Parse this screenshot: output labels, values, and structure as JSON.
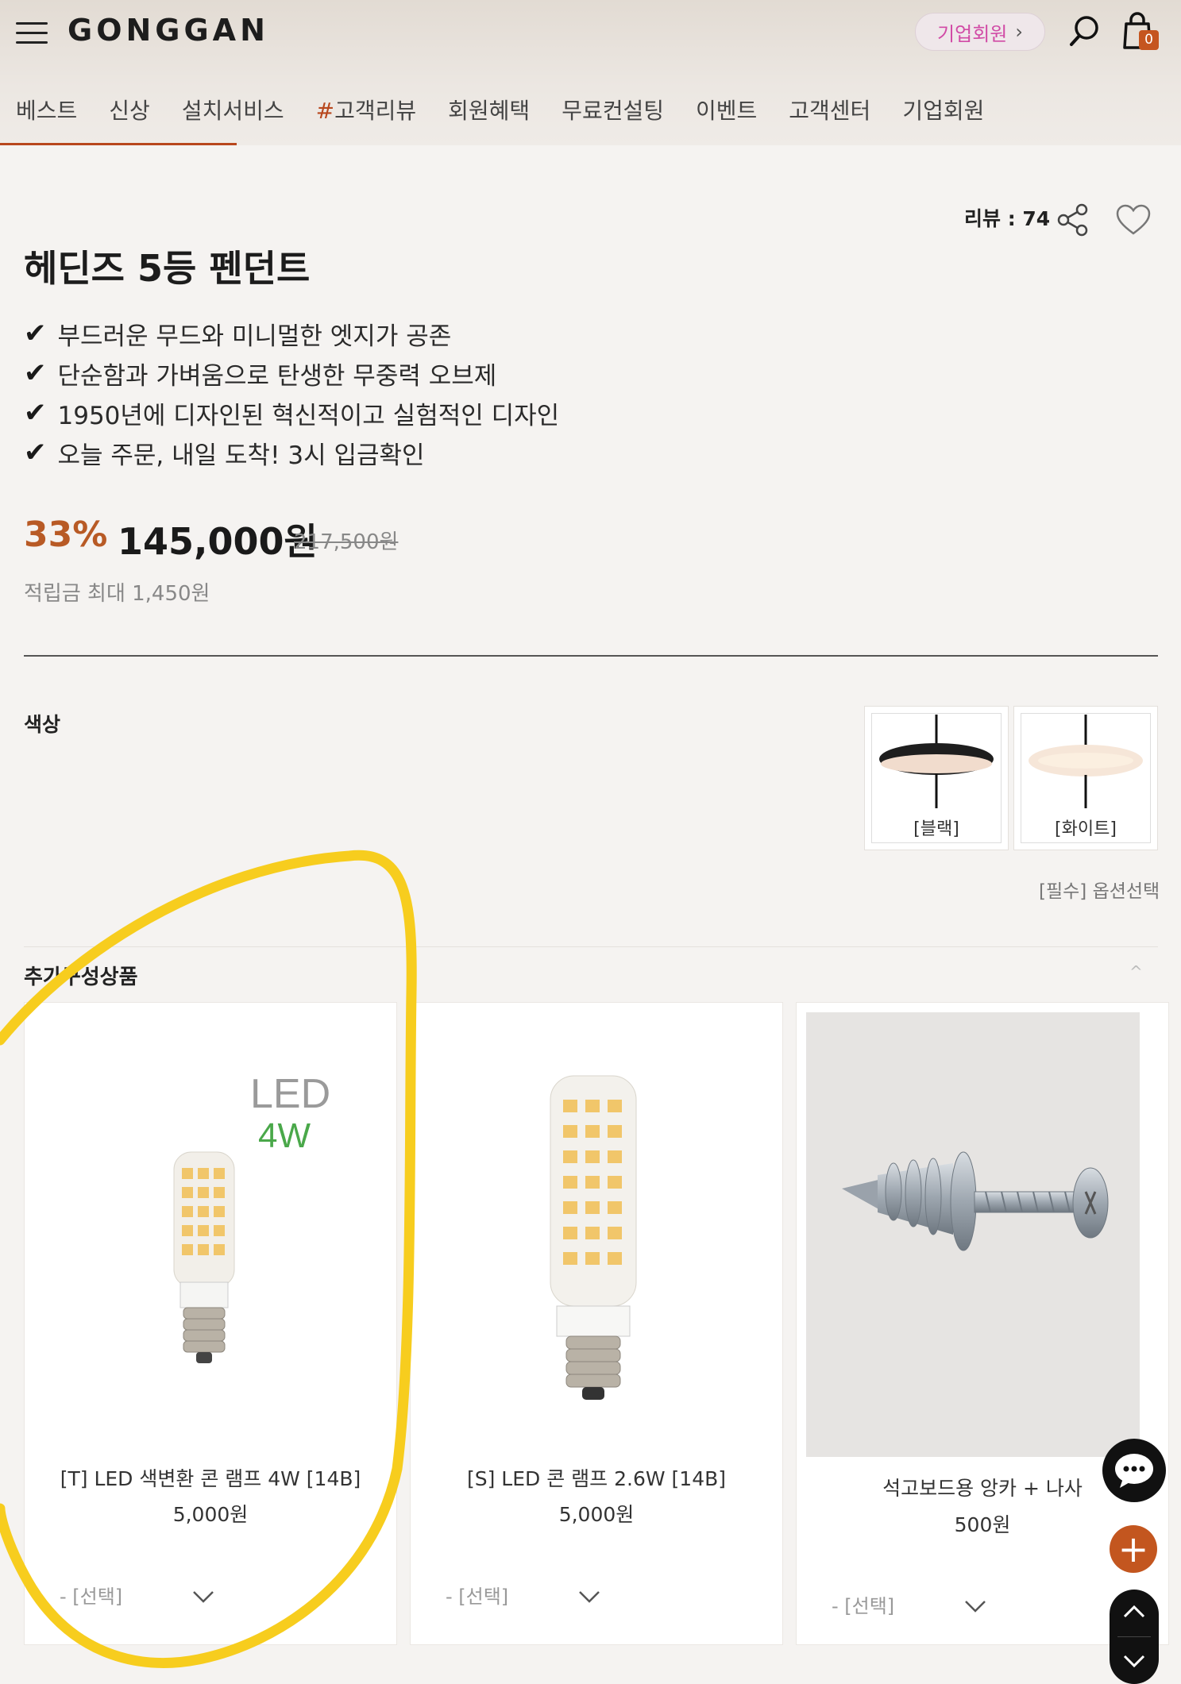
{
  "header": {
    "logo": "GONGGAN",
    "biz_pill_label": "기업회원",
    "biz_pill_chevron": "›",
    "cart_count": "0"
  },
  "nav": {
    "items": [
      "베스트",
      "신상",
      "설치서비스",
      "#고객리뷰",
      "회원혜택",
      "무료컨설팅",
      "이벤트",
      "고객센터",
      "기업회원"
    ],
    "active_index": 0,
    "accent_color": "#b8471d"
  },
  "product": {
    "review_label": "리뷰 : 74",
    "title": "헤딘즈 5등 펜던트",
    "features": [
      "부드러운 무드와 미니멀한 엣지가 공존",
      "단순함과 가벼움으로 탄생한 무중력 오브제",
      "1950년에 디자인된 혁신적이고 실험적인 디자인",
      "오늘 주문, 내일 도착! 3시 입금확인"
    ],
    "check_glyph": "✔",
    "discount": "33%",
    "price": "145,000원",
    "original_price": "217,500원",
    "points": "적립금  최대 1,450원"
  },
  "color": {
    "label": "색상",
    "options": [
      "[블랙]",
      "[화이트]"
    ],
    "required_text": "[필수] 옵션선택"
  },
  "addon": {
    "title": "추가구성상품",
    "toggle_glyph": "^",
    "items": [
      {
        "name": "[T] LED 색변환 콘 램프 4W [14B]",
        "price": "5,000원",
        "select": "- [선택]",
        "image_text_1": "LED",
        "image_text_2": "4W"
      },
      {
        "name": "[S] LED 콘 램프 2.6W [14B]",
        "price": "5,000원",
        "select": "- [선택]"
      },
      {
        "name": "석고보드용 앙카 + 나사",
        "price": "500원",
        "select": "- [선택]"
      }
    ]
  },
  "fab": {
    "plus_glyph": "+"
  },
  "colors": {
    "discount": "#b85a25",
    "annotation": "#f7cd1e",
    "biz_pill_text": "#d14ba6"
  }
}
